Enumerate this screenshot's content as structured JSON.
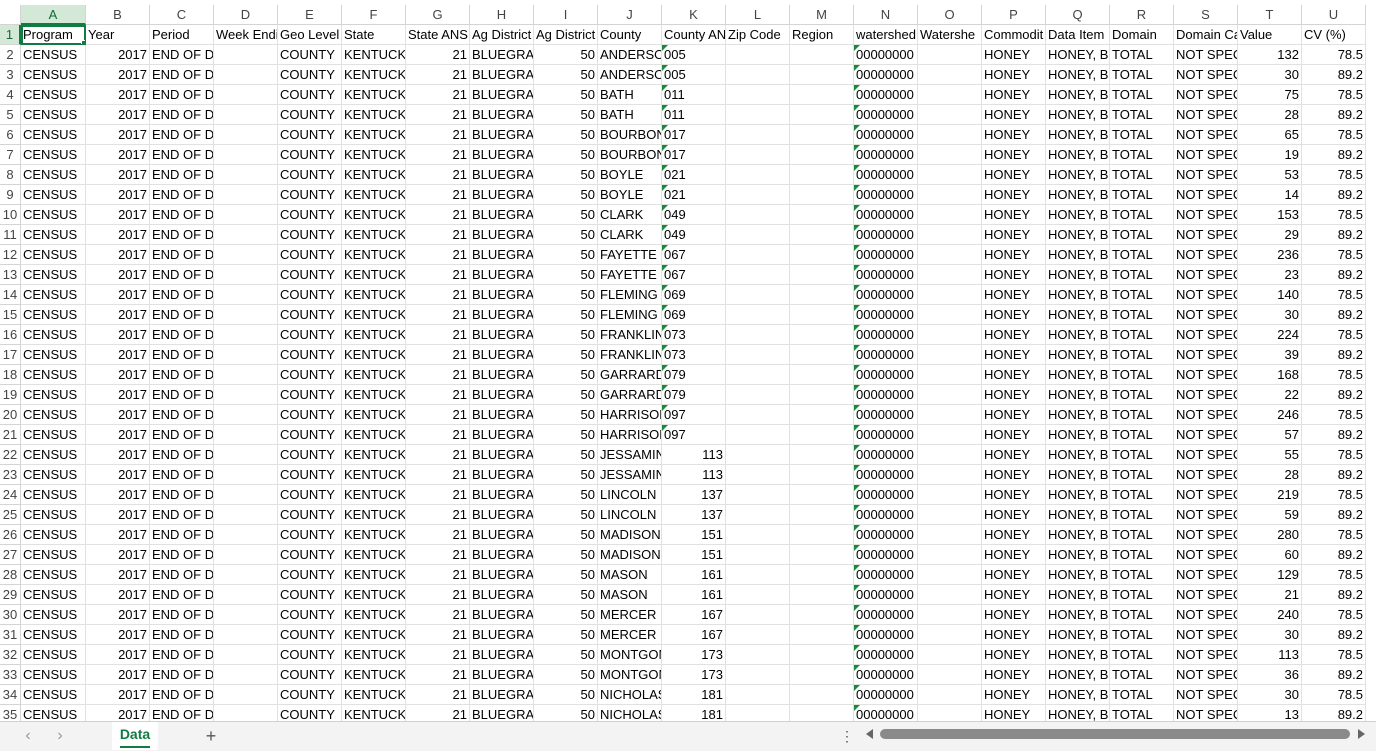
{
  "columns": [
    {
      "letter": "A",
      "w": 65
    },
    {
      "letter": "B",
      "w": 64
    },
    {
      "letter": "C",
      "w": 64
    },
    {
      "letter": "D",
      "w": 64
    },
    {
      "letter": "E",
      "w": 64
    },
    {
      "letter": "F",
      "w": 64
    },
    {
      "letter": "G",
      "w": 64
    },
    {
      "letter": "H",
      "w": 64
    },
    {
      "letter": "I",
      "w": 64
    },
    {
      "letter": "J",
      "w": 64
    },
    {
      "letter": "K",
      "w": 64
    },
    {
      "letter": "L",
      "w": 64
    },
    {
      "letter": "M",
      "w": 64
    },
    {
      "letter": "N",
      "w": 64
    },
    {
      "letter": "O",
      "w": 64
    },
    {
      "letter": "P",
      "w": 64
    },
    {
      "letter": "Q",
      "w": 64
    },
    {
      "letter": "R",
      "w": 64
    },
    {
      "letter": "S",
      "w": 64
    },
    {
      "letter": "T",
      "w": 64
    },
    {
      "letter": "U",
      "w": 64
    }
  ],
  "headers": [
    "Program",
    "Year",
    "Period",
    "Week Endi",
    "Geo Level",
    "State",
    "State ANS",
    "Ag District",
    "Ag District",
    "County",
    "County AN",
    "Zip Code",
    "Region",
    "watershed",
    "Watershe",
    "Commodit",
    "Data Item",
    "Domain",
    "Domain Ca",
    "Value",
    "CV (%)"
  ],
  "constants": {
    "program": "CENSUS",
    "year": "2017",
    "period": "END OF DEC",
    "geo": "COUNTY",
    "state": "KENTUCKY",
    "state_ansi": "21",
    "ag_district": "BLUEGRASS",
    "ag_district_code": "50",
    "watershed": "00000000",
    "commodity": "HONEY",
    "data_item": "HONEY, BEE COLONIES",
    "domain": "TOTAL",
    "domain_cat": "NOT SPECIFIED"
  },
  "data_rows": [
    {
      "row": 2,
      "county": "ANDERSON",
      "code": "005",
      "text_code": true,
      "value": "132",
      "cv": "78.5"
    },
    {
      "row": 3,
      "county": "ANDERSON",
      "code": "005",
      "text_code": true,
      "value": "30",
      "cv": "89.2"
    },
    {
      "row": 4,
      "county": "BATH",
      "code": "011",
      "text_code": true,
      "value": "75",
      "cv": "78.5"
    },
    {
      "row": 5,
      "county": "BATH",
      "code": "011",
      "text_code": true,
      "value": "28",
      "cv": "89.2"
    },
    {
      "row": 6,
      "county": "BOURBON",
      "code": "017",
      "text_code": true,
      "value": "65",
      "cv": "78.5"
    },
    {
      "row": 7,
      "county": "BOURBON",
      "code": "017",
      "text_code": true,
      "value": "19",
      "cv": "89.2"
    },
    {
      "row": 8,
      "county": "BOYLE",
      "code": "021",
      "text_code": true,
      "value": "53",
      "cv": "78.5"
    },
    {
      "row": 9,
      "county": "BOYLE",
      "code": "021",
      "text_code": true,
      "value": "14",
      "cv": "89.2"
    },
    {
      "row": 10,
      "county": "CLARK",
      "code": "049",
      "text_code": true,
      "value": "153",
      "cv": "78.5"
    },
    {
      "row": 11,
      "county": "CLARK",
      "code": "049",
      "text_code": true,
      "value": "29",
      "cv": "89.2"
    },
    {
      "row": 12,
      "county": "FAYETTE",
      "code": "067",
      "text_code": true,
      "value": "236",
      "cv": "78.5"
    },
    {
      "row": 13,
      "county": "FAYETTE",
      "code": "067",
      "text_code": true,
      "value": "23",
      "cv": "89.2"
    },
    {
      "row": 14,
      "county": "FLEMING",
      "code": "069",
      "text_code": true,
      "value": "140",
      "cv": "78.5"
    },
    {
      "row": 15,
      "county": "FLEMING",
      "code": "069",
      "text_code": true,
      "value": "30",
      "cv": "89.2"
    },
    {
      "row": 16,
      "county": "FRANKLIN",
      "code": "073",
      "text_code": true,
      "value": "224",
      "cv": "78.5"
    },
    {
      "row": 17,
      "county": "FRANKLIN",
      "code": "073",
      "text_code": true,
      "value": "39",
      "cv": "89.2"
    },
    {
      "row": 18,
      "county": "GARRARD",
      "code": "079",
      "text_code": true,
      "value": "168",
      "cv": "78.5"
    },
    {
      "row": 19,
      "county": "GARRARD",
      "code": "079",
      "text_code": true,
      "value": "22",
      "cv": "89.2"
    },
    {
      "row": 20,
      "county": "HARRISON",
      "code": "097",
      "text_code": true,
      "value": "246",
      "cv": "78.5"
    },
    {
      "row": 21,
      "county": "HARRISON",
      "code": "097",
      "text_code": true,
      "value": "57",
      "cv": "89.2"
    },
    {
      "row": 22,
      "county": "JESSAMINE",
      "code": "113",
      "text_code": false,
      "value": "55",
      "cv": "78.5"
    },
    {
      "row": 23,
      "county": "JESSAMINE",
      "code": "113",
      "text_code": false,
      "value": "28",
      "cv": "89.2"
    },
    {
      "row": 24,
      "county": "LINCOLN",
      "code": "137",
      "text_code": false,
      "value": "219",
      "cv": "78.5"
    },
    {
      "row": 25,
      "county": "LINCOLN",
      "code": "137",
      "text_code": false,
      "value": "59",
      "cv": "89.2"
    },
    {
      "row": 26,
      "county": "MADISON",
      "code": "151",
      "text_code": false,
      "value": "280",
      "cv": "78.5"
    },
    {
      "row": 27,
      "county": "MADISON",
      "code": "151",
      "text_code": false,
      "value": "60",
      "cv": "89.2"
    },
    {
      "row": 28,
      "county": "MASON",
      "code": "161",
      "text_code": false,
      "value": "129",
      "cv": "78.5"
    },
    {
      "row": 29,
      "county": "MASON",
      "code": "161",
      "text_code": false,
      "value": "21",
      "cv": "89.2"
    },
    {
      "row": 30,
      "county": "MERCER",
      "code": "167",
      "text_code": false,
      "value": "240",
      "cv": "78.5"
    },
    {
      "row": 31,
      "county": "MERCER",
      "code": "167",
      "text_code": false,
      "value": "30",
      "cv": "89.2"
    },
    {
      "row": 32,
      "county": "MONTGOMERY",
      "code": "173",
      "text_code": false,
      "value": "113",
      "cv": "78.5"
    },
    {
      "row": 33,
      "county": "MONTGOMERY",
      "code": "173",
      "text_code": false,
      "value": "36",
      "cv": "89.2"
    },
    {
      "row": 34,
      "county": "NICHOLAS",
      "code": "181",
      "text_code": false,
      "value": "30",
      "cv": "78.5"
    },
    {
      "row": 35,
      "county": "NICHOLAS",
      "code": "181",
      "text_code": false,
      "value": "13",
      "cv": "89.2"
    }
  ],
  "tabbar": {
    "prev_icon": "‹",
    "next_icon": "›",
    "sheet_tab": "Data",
    "add_icon": "+",
    "menu_icon": "⋮"
  },
  "colors": {
    "accent": "#107c41",
    "selected_header": "#d3e8d6",
    "error_triangle": "#1a8a3a"
  }
}
